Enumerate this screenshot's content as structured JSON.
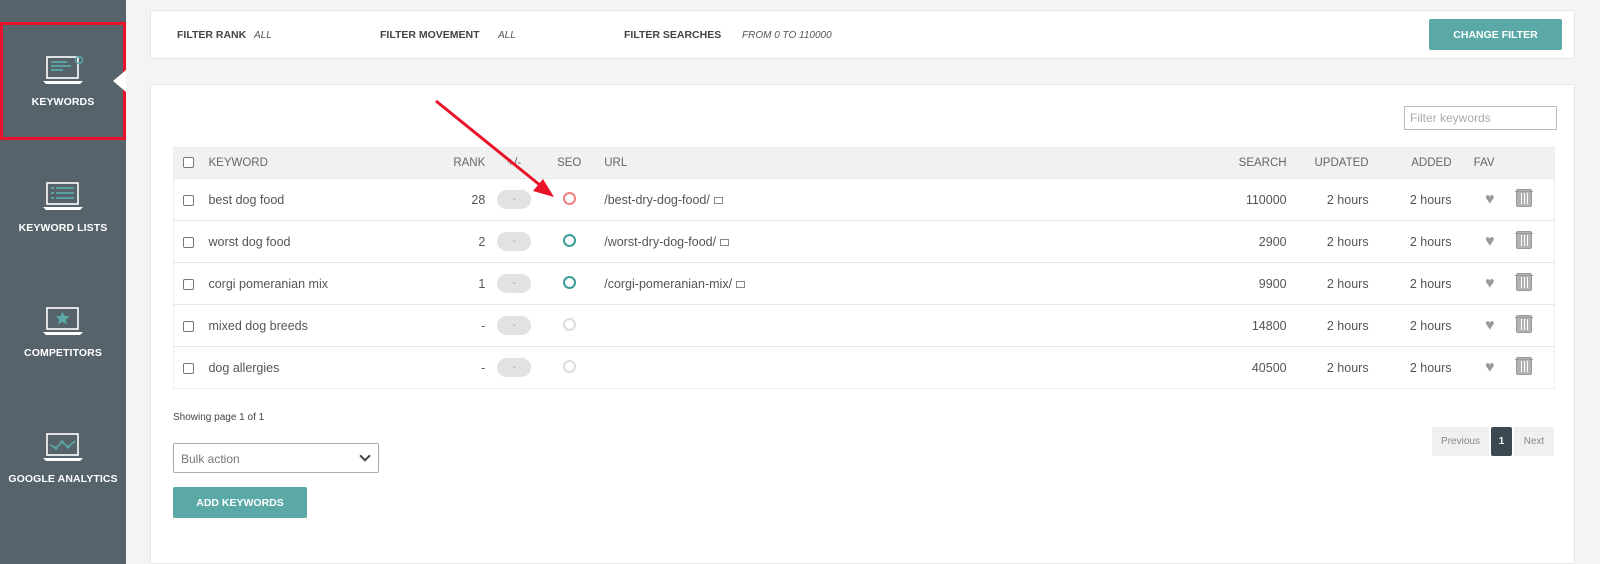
{
  "sidebar": {
    "items": [
      {
        "label": "KEYWORDS",
        "icon": "laptop-keywords-icon",
        "active": true
      },
      {
        "label": "KEYWORD LISTS",
        "icon": "laptop-list-icon",
        "active": false
      },
      {
        "label": "COMPETITORS",
        "icon": "laptop-star-icon",
        "active": false
      },
      {
        "label": "GOOGLE ANALYTICS",
        "icon": "laptop-chart-icon",
        "active": false
      }
    ]
  },
  "filters": {
    "rank_label": "FILTER RANK",
    "rank_value": "ALL",
    "movement_label": "FILTER MOVEMENT",
    "movement_value": "ALL",
    "searches_label": "FILTER SEARCHES",
    "searches_value": "FROM 0 TO 110000",
    "change_button": "CHANGE FILTER"
  },
  "search": {
    "placeholder": "Filter keywords"
  },
  "table": {
    "headers": {
      "keyword": "KEYWORD",
      "rank": "RANK",
      "movement": "+/-",
      "seo": "SEO",
      "url": "URL",
      "search": "SEARCH",
      "updated": "UPDATED",
      "added": "ADDED",
      "fav": "FAV"
    },
    "rows": [
      {
        "keyword": "best dog food",
        "rank": "28",
        "movement": "-",
        "seo": "red",
        "url": "/best-dry-dog-food/",
        "search": "110000",
        "updated": "2 hours",
        "added": "2 hours"
      },
      {
        "keyword": "worst dog food",
        "rank": "2",
        "movement": "-",
        "seo": "green",
        "url": "/worst-dry-dog-food/",
        "search": "2900",
        "updated": "2 hours",
        "added": "2 hours"
      },
      {
        "keyword": "corgi pomeranian mix",
        "rank": "1",
        "movement": "-",
        "seo": "green",
        "url": "/corgi-pomeranian-mix/",
        "search": "9900",
        "updated": "2 hours",
        "added": "2 hours"
      },
      {
        "keyword": "mixed dog breeds",
        "rank": "-",
        "movement": "-",
        "seo": "none",
        "url": "",
        "search": "14800",
        "updated": "2 hours",
        "added": "2 hours"
      },
      {
        "keyword": "dog allergies",
        "rank": "-",
        "movement": "-",
        "seo": "none",
        "url": "",
        "search": "40500",
        "updated": "2 hours",
        "added": "2 hours"
      }
    ]
  },
  "footer": {
    "showing": "Showing page 1 of 1",
    "bulk_action": "Bulk action",
    "add_keywords": "ADD KEYWORDS",
    "pagination": {
      "previous": "Previous",
      "current": "1",
      "next": "Next"
    }
  },
  "colors": {
    "sidebar": "#56636b",
    "accent": "#5aa9a6",
    "seo_red": "#f08080",
    "seo_green": "#3a9e97",
    "seo_none": "#dddddd",
    "highlight": "#e8132a"
  }
}
